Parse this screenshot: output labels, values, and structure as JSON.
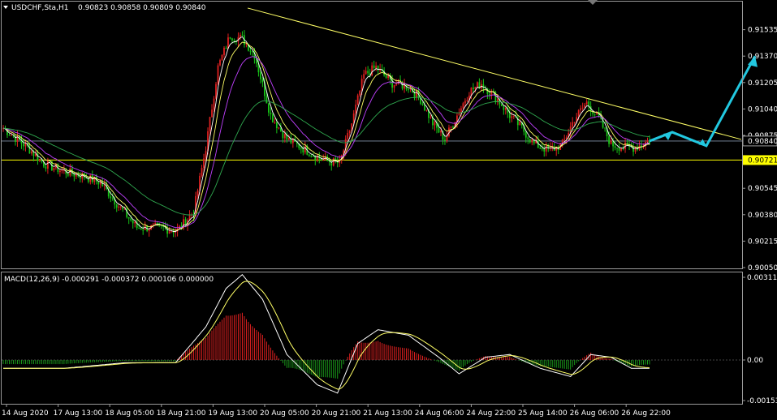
{
  "chart_data": [
    {
      "type": "candlestick",
      "title": "USDCHF,Sta,H1",
      "ohlc_label": "0.90823 0.90858 0.90809 0.90840",
      "ylim": [
        0.9005,
        0.917
      ],
      "y_ticks": [
        "0.91535",
        "0.91370",
        "0.91205",
        "0.91040",
        "0.90875",
        "0.90721",
        "0.90545",
        "0.90380",
        "0.90215",
        "0.90050"
      ],
      "current_price": "0.90840",
      "hline_price": "0.90721",
      "x_ticks": [
        "14 Aug 2020",
        "17 Aug 13:00",
        "18 Aug 05:00",
        "18 Aug 21:00",
        "19 Aug 13:00",
        "20 Aug 05:00",
        "20 Aug 21:00",
        "21 Aug 13:00",
        "24 Aug 06:00",
        "24 Aug 22:00",
        "25 Aug 14:00",
        "26 Aug 06:00",
        "26 Aug 22:00"
      ],
      "key_closes": [
        [
          0,
          0.9092
        ],
        [
          12,
          0.908
        ],
        [
          20,
          0.907
        ],
        [
          30,
          0.9065
        ],
        [
          40,
          0.9062
        ],
        [
          48,
          0.9058
        ],
        [
          58,
          0.9042
        ],
        [
          66,
          0.903
        ],
        [
          76,
          0.903
        ],
        [
          86,
          0.9028
        ],
        [
          94,
          0.904
        ],
        [
          100,
          0.908
        ],
        [
          106,
          0.913
        ],
        [
          112,
          0.915
        ],
        [
          118,
          0.9148
        ],
        [
          124,
          0.9138
        ],
        [
          132,
          0.91
        ],
        [
          140,
          0.9085
        ],
        [
          150,
          0.9078
        ],
        [
          158,
          0.9072
        ],
        [
          166,
          0.907
        ],
        [
          172,
          0.9095
        ],
        [
          178,
          0.9125
        ],
        [
          184,
          0.913
        ],
        [
          192,
          0.912
        ],
        [
          200,
          0.9118
        ],
        [
          206,
          0.911
        ],
        [
          212,
          0.9095
        ],
        [
          218,
          0.9085
        ],
        [
          224,
          0.91
        ],
        [
          230,
          0.9115
        ],
        [
          236,
          0.912
        ],
        [
          244,
          0.911
        ],
        [
          250,
          0.91
        ],
        [
          256,
          0.9092
        ],
        [
          262,
          0.9082
        ],
        [
          270,
          0.9078
        ],
        [
          276,
          0.9082
        ],
        [
          282,
          0.9098
        ],
        [
          288,
          0.9108
        ],
        [
          294,
          0.9098
        ],
        [
          300,
          0.9082
        ],
        [
          306,
          0.908
        ],
        [
          312,
          0.908
        ],
        [
          318,
          0.9084
        ]
      ],
      "trendline": [
        [
          0.9167,
          0.9085
        ]
      ],
      "projection_arrow": [
        0.9084,
        0.90895,
        0.9081,
        0.9137
      ]
    },
    {
      "type": "macd",
      "label": "MACD(12,26,9) -0.000291 -0.000372 0.000106 0.000000",
      "ylim": [
        -0.00153,
        0.00312
      ],
      "y_ticks": [
        "0.003112",
        "0.00",
        "-0.001535"
      ],
      "key_values": [
        [
          0,
          -0.0003
        ],
        [
          30,
          -0.0003
        ],
        [
          60,
          -0.0001
        ],
        [
          85,
          -0.0001
        ],
        [
          100,
          0.0012
        ],
        [
          110,
          0.0026
        ],
        [
          118,
          0.0031
        ],
        [
          128,
          0.0022
        ],
        [
          140,
          0.0002
        ],
        [
          155,
          -0.0009
        ],
        [
          165,
          -0.0012
        ],
        [
          175,
          0.0006
        ],
        [
          185,
          0.0011
        ],
        [
          200,
          0.0009
        ],
        [
          215,
          0.0001
        ],
        [
          225,
          -0.0005
        ],
        [
          238,
          0.0001
        ],
        [
          250,
          0.0002
        ],
        [
          265,
          -0.0003
        ],
        [
          280,
          -0.0006
        ],
        [
          290,
          0.0002
        ],
        [
          300,
          0.0001
        ],
        [
          310,
          -0.0003
        ],
        [
          318,
          -0.0003
        ]
      ]
    }
  ]
}
